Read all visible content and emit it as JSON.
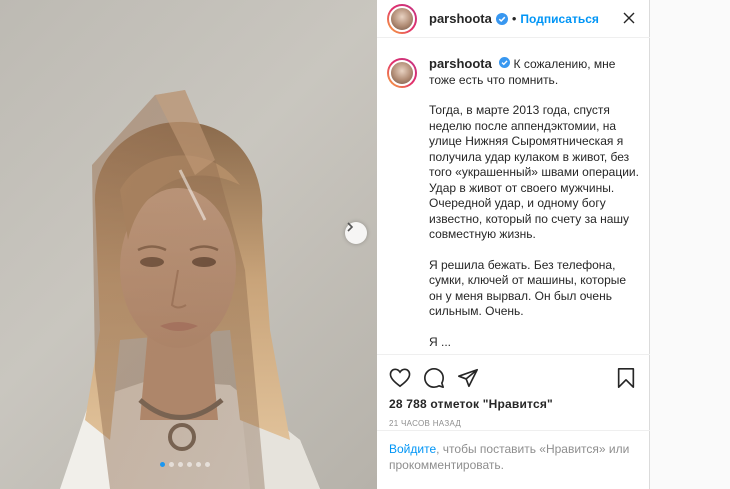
{
  "header": {
    "username": "parshoota",
    "separator": "•",
    "follow_label": "Подписаться"
  },
  "caption": {
    "username": "parshoota",
    "first_line": "К сожалению, мне тоже есть что помнить.",
    "paragraph_1": "Тогда, в марте 2013 года, спустя неделю после аппендэктомии, на улице Нижняя Сыромятническая я получила удар кулаком в живот, без того «украшенный» швами операции. Удар в живот от своего мужчины.",
    "paragraph_2": "Очередной удар, и одному богу известно, который по счету за нашу совместную жизнь.",
    "paragraph_3": "Я решила бежать. Без телефона, сумки, ключей от машины, которые он у меня вырвал. Он был очень сильным. Очень.",
    "paragraph_4_partial": "Я ..."
  },
  "actions": {
    "likes": "28 788 отметок \"Нравится\"",
    "time": "21 ЧАСОВ НАЗАД"
  },
  "login_prompt": {
    "link": "Войдите",
    "rest": ", чтобы поставить «Нравится» или прокомментировать."
  },
  "carousel": {
    "slides": 6,
    "active_index": 0
  },
  "icons": {
    "verified": "verified-badge-icon",
    "more": "more-options-icon",
    "like": "heart-icon",
    "comment": "comment-bubble-icon",
    "share": "paper-plane-icon",
    "save": "bookmark-icon",
    "next": "chevron-right-icon"
  },
  "colors": {
    "accent": "#0095f6",
    "verified": "#3897f0",
    "text": "#262626",
    "muted": "#8e8e8e"
  }
}
